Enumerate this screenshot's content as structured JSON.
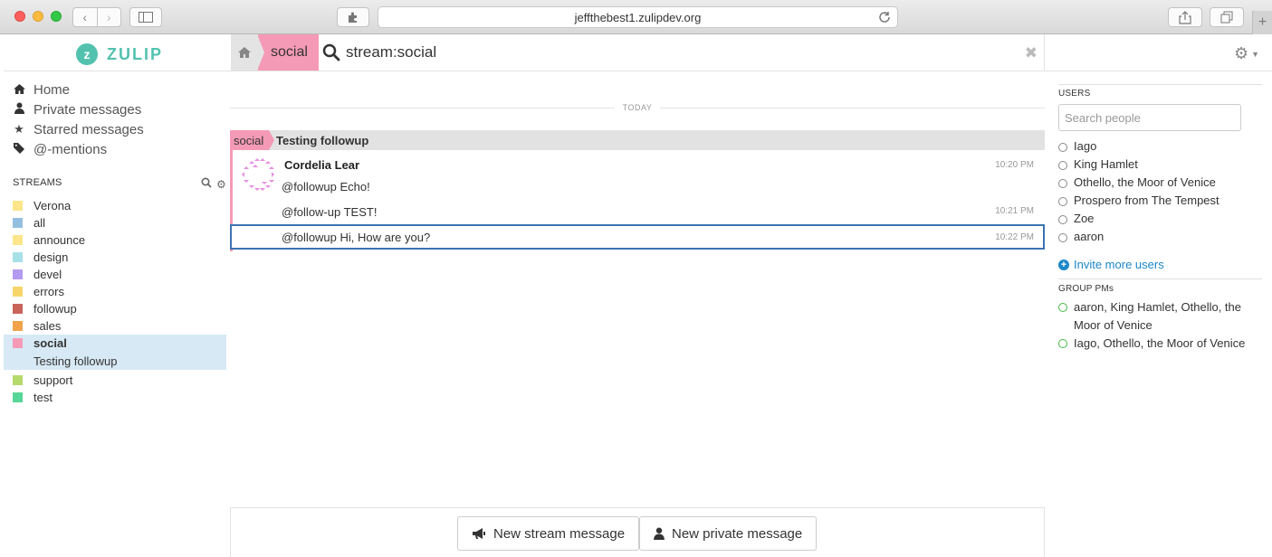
{
  "browser": {
    "url": "jeffthebest1.zulipdev.org"
  },
  "header": {
    "logo_letter": "z",
    "logo_text": "ZULIP",
    "stream_crumb": "social",
    "search_query": "stream:social"
  },
  "nav": {
    "items": [
      {
        "label": "Home",
        "icon": "home-icon"
      },
      {
        "label": "Private messages",
        "icon": "user-icon"
      },
      {
        "label": "Starred messages",
        "icon": "star-icon"
      },
      {
        "label": "@-mentions",
        "icon": "tag-icon"
      }
    ]
  },
  "streams": {
    "header": "STREAMS",
    "items": [
      {
        "name": "Verona",
        "color": "#fce58a"
      },
      {
        "name": "all",
        "color": "#94c0e0"
      },
      {
        "name": "announce",
        "color": "#fce58a"
      },
      {
        "name": "design",
        "color": "#a8e0e8"
      },
      {
        "name": "devel",
        "color": "#b49af0"
      },
      {
        "name": "errors",
        "color": "#f8d56a"
      },
      {
        "name": "followup",
        "color": "#c8645a"
      },
      {
        "name": "sales",
        "color": "#f0a34a"
      },
      {
        "name": "social",
        "color": "#f59ab6",
        "active": true,
        "topic": "Testing followup"
      },
      {
        "name": "support",
        "color": "#b6da6c"
      },
      {
        "name": "test",
        "color": "#56d697"
      }
    ]
  },
  "messages": {
    "date_divider": "TODAY",
    "recipient_stream": "social",
    "recipient_topic": "Testing followup",
    "sender": "Cordelia Lear",
    "items": [
      {
        "text": "@followup Echo!",
        "time": "10:20 PM"
      },
      {
        "text": "@follow-up TEST!",
        "time": "10:21 PM"
      },
      {
        "text": "@followup Hi, How are you?",
        "time": "10:22 PM"
      }
    ]
  },
  "compose": {
    "new_stream": "New stream message",
    "new_private": "New private message"
  },
  "users": {
    "header": "USERS",
    "search_placeholder": "Search people",
    "list": [
      "Iago",
      "King Hamlet",
      "Othello, the Moor of Venice",
      "Prospero from The Tempest",
      "Zoe",
      "aaron"
    ],
    "invite": "Invite more users"
  },
  "group_pms": {
    "header": "GROUP PMs",
    "list": [
      "aaron, King Hamlet, Othello, the Moor of Venice",
      "Iago, Othello, the Moor of Venice"
    ]
  },
  "colors": {
    "brand": "#52c2af",
    "social_stream": "#f59ab6",
    "selected_border": "#3c73b2",
    "link": "#1c87c9"
  }
}
